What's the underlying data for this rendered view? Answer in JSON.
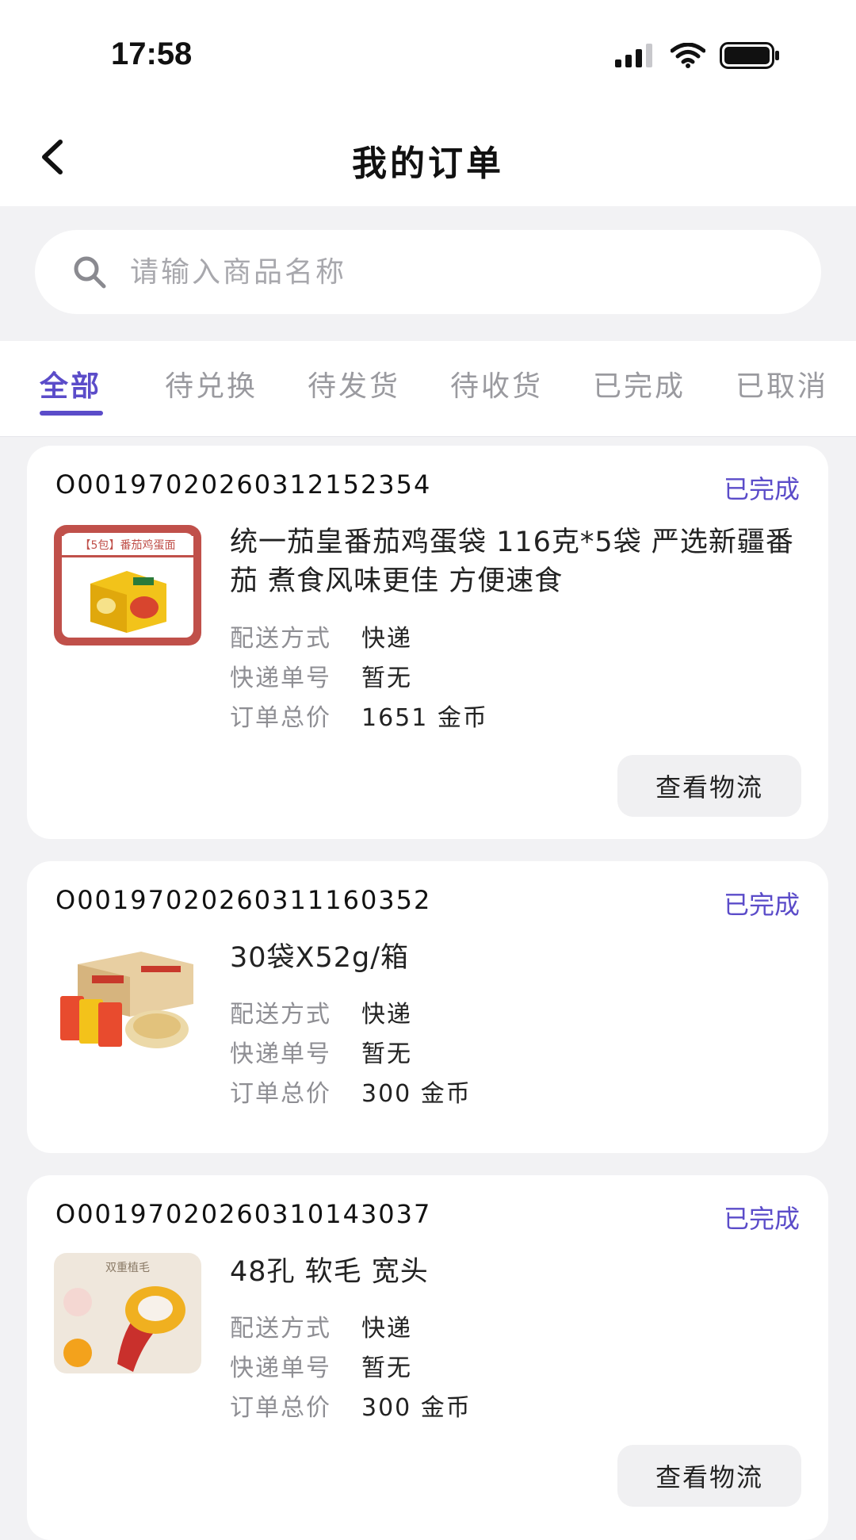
{
  "status_bar": {
    "time": "17:58"
  },
  "nav": {
    "title": "我的订单"
  },
  "search": {
    "placeholder": "请输入商品名称"
  },
  "tabs": [
    {
      "label": "全部",
      "active": true
    },
    {
      "label": "待兑换",
      "active": false
    },
    {
      "label": "待发货",
      "active": false
    },
    {
      "label": "待收货",
      "active": false
    },
    {
      "label": "已完成",
      "active": false
    },
    {
      "label": "已取消",
      "active": false
    }
  ],
  "labels": {
    "delivery_method": "配送方式",
    "tracking_no": "快递单号",
    "total_price": "订单总价",
    "logistics_button": "查看物流"
  },
  "orders": [
    {
      "order_no": "O00197020260312152354",
      "status": "已完成",
      "title": "统一茄皇番茄鸡蛋袋 116克*5袋 严选新疆番茄 煮食风味更佳 方便速食",
      "image_caption": "【5包】番茄鸡蛋面",
      "delivery": "快递",
      "tracking": "暂无",
      "total": "1651 金币"
    },
    {
      "order_no": "O00197020260311160352",
      "status": "已完成",
      "title": "30袋X52g/箱",
      "delivery": "快递",
      "tracking": "暂无",
      "total": "300 金币"
    },
    {
      "order_no": "O00197020260310143037",
      "status": "已完成",
      "title": "48孔 软毛 宽头",
      "image_caption": "双重植毛",
      "delivery": "快递",
      "tracking": "暂无",
      "total": "300 金币"
    }
  ],
  "colors": {
    "accent": "#5b4cc9",
    "background": "#f2f2f4",
    "card": "#ffffff"
  }
}
